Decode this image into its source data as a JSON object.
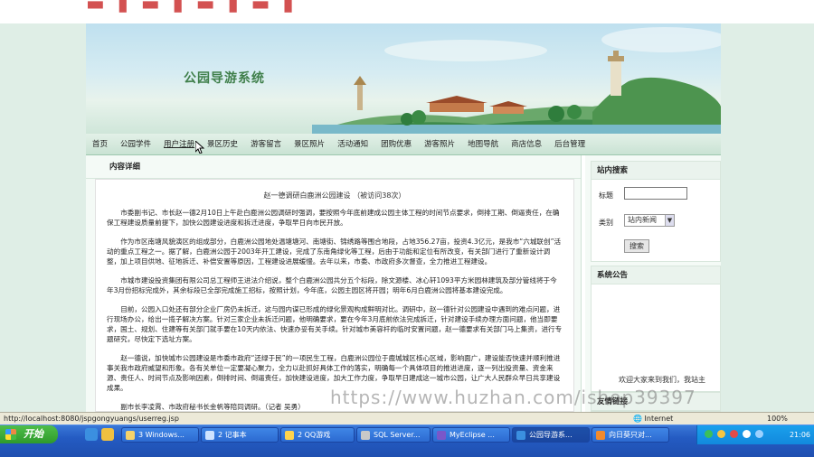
{
  "site": {
    "title": "公园导游系统"
  },
  "nav": {
    "items": [
      "首页",
      "公园学件",
      "用户注册",
      "景区历史",
      "游客留言",
      "景区照片",
      "活动通知",
      "团购优惠",
      "游客照片",
      "地图导航",
      "商店信息",
      "后台管理"
    ]
  },
  "content": {
    "section_header": "内容详细",
    "article_title": "赵一德调研白鹿洲公园建设",
    "article_views": "（被访问38次）",
    "paragraphs": [
      "市委副书记、市长赵一德2月10日上午赴白鹿洲公园调研时强调，要按照今年底前建成公园主体工程的时间节点要求，倒排工期、倒逼责任，在确保工程建设质量前提下，加快公园建设进度和拆迁进度，争取早日向市民开放。",
      "作为市区南塘风貌演区的组成部分，白鹿洲公园地处温塘塘河、南塘街、锦绣路等围合地段，占地356.27亩，投资4.3亿元，是我市“六城联创”活动的重点工程之一。据了解，白鹿洲公园于2003年开工建设，完成了东南角绿化等工程，后由于功能和定位有所改变，有关部门进行了重新设计调整，加上项目供地、征地拆迁、补偿安置等原因，工程建设进展缓慢。去年以来，市委、市政府多次督查，全力推进工程建设。",
      "市城市建设投资集团有限公司总工程师王进法介绍说，整个白鹿洲公园共分五个标段，除文源楼、冰心轩1093平方米园林建筑及部分管线将于今年3月份招标完成外，其余标段已全部完成施工招标，按照计划，今年底，公园主园区将开园；明年6月白鹿洲公园将基本建设完成。",
      "目前，公园入口处还有部分企业厂房仍未拆迁，这与园内谋已形成的绿化景观构成鲜明对比。调研中，赵一德针对公园建设中遇到的难点问题，进行现场办公，给出一揽子解决方案。针对三家企业未拆迁问题，他明确要求，要在今年3月底前依法完成拆迁，针对建设手续办理方面问题，他当即要求，国土、规划、住建等有关部门就手要在10天内依法、快速办妥有关手续。针对城市美容杆的临时安置问题，赵一德要求有关部门马上集资，进行专题研究，尽快定下选址方案。",
      "赵一德说，加快城市公园建设是市委市政府“还绿于民”的一项民生工程，白鹿洲公园位于鹿城城区核心区域，影响面广，建设能否快速并顺利推进事关我市政府威望和形象。各有关单位一定要凝心聚力，全力以赴抓好具体工作的落实，明确每一个具体项目的推进进度，逐一列出投资量、资金来源、责任人、时间节点及影响因素，倒排时间、倒逼责任，加快建设进度，加大工作力度，争取早日建成这一城市公园，让广大人民群众早日共享建设成果。",
      "副市长李凌霄、市政府秘书长金帆等陪同调研。（记者 吴勇）"
    ]
  },
  "sidebar": {
    "search_header": "站内搜索",
    "title_label": "标题",
    "title_value": "",
    "category_label": "类别",
    "category_value": "站内新闻",
    "search_button": "搜索",
    "notice_header": "系统公告",
    "notice_text": "欢迎大家来到我们，我站主",
    "friend_header": "友情链接"
  },
  "status": {
    "url": "http://localhost:8080/jspgongyuangs/userreg.jsp",
    "zone": "Internet",
    "zoom": "100%"
  },
  "taskbar": {
    "start": "开始",
    "tasks": [
      "3 Windows...",
      "2 记事本",
      "2 QQ游戏",
      "SQL Server...",
      "MyEclipse ...",
      "公园导游系...",
      "向日葵只对..."
    ],
    "clock": "21:06"
  },
  "watermark": "https://www.huzhan.com/ishop39397",
  "colors": {
    "nav_bg": "#d6eadc",
    "title_green": "#3f7f4a",
    "taskbar": "#245bc2",
    "start_green": "#2e9a2b"
  }
}
